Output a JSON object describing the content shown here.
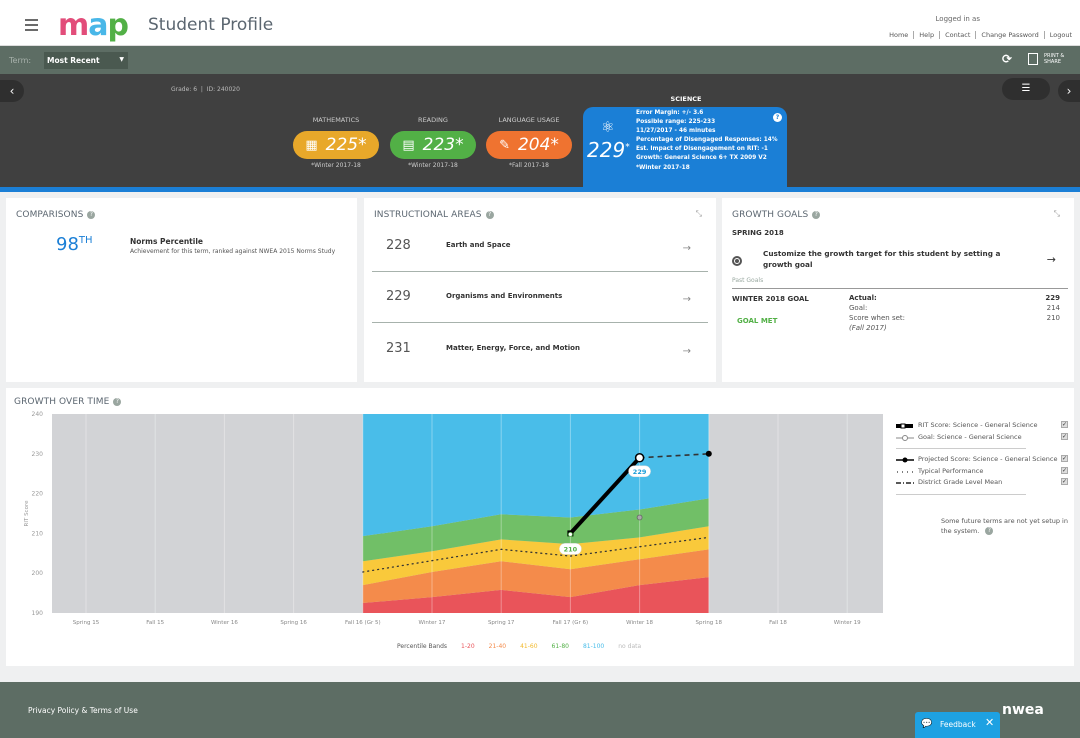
{
  "header": {
    "app_title": "Student Profile",
    "logo_text": "map",
    "logged_in_label": "Logged in as",
    "links": [
      "Home",
      "Help",
      "Contact",
      "Change Password",
      "Logout"
    ]
  },
  "term_bar": {
    "term_label": "Term:",
    "term_selected": "Most Recent",
    "refresh_icon": "refresh-icon",
    "print_label_1": "PRINT &",
    "print_label_2": "SHARE"
  },
  "student_bar": {
    "grade": "Grade: 6",
    "id": "ID: 240020",
    "prev_icon": "chevron-left",
    "next_icon": "chevron-right",
    "roster_icon": "user-list-icon"
  },
  "subjects": [
    {
      "name": "MATHEMATICS",
      "score": "225*",
      "term": "*Winter 2017-18",
      "color": "#e8a82a",
      "icon": "calculator-icon"
    },
    {
      "name": "READING",
      "score": "223*",
      "term": "*Winter 2017-18",
      "color": "#52b046",
      "icon": "book-icon"
    },
    {
      "name": "LANGUAGE USAGE",
      "score": "204*",
      "term": "*Fall 2017-18",
      "color": "#ef7330",
      "icon": "pencil-paper-icon"
    }
  ],
  "science": {
    "name": "SCIENCE",
    "score": "229",
    "asterisk": "*",
    "color": "#1b7fd6",
    "details": [
      "Error Margin: +/- 3.6",
      "Possible range: 225-233",
      "11/27/2017 - 46 minutes",
      "Percentage of Disengaged Responses: 14%",
      "Est. Impact of Disengagement on RIT: -1",
      "Growth: General Science 6+ TX 2009 V2",
      "*Winter 2017-18"
    ]
  },
  "comparisons": {
    "title": "COMPARISONS",
    "percentile": "98",
    "suffix": "TH",
    "label": "Norms Percentile",
    "description": "Achievement for this term, ranked against NWEA 2015 Norms Study"
  },
  "instructional_areas": {
    "title": "INSTRUCTIONAL AREAS",
    "rows": [
      {
        "score": "228",
        "name": "Earth and Space"
      },
      {
        "score": "229",
        "name": "Organisms and Environments"
      },
      {
        "score": "231",
        "name": "Matter, Energy, Force, and Motion"
      }
    ]
  },
  "growth_goals": {
    "title": "GROWTH GOALS",
    "season": "SPRING 2018",
    "prompt": "Customize the growth target for this student by setting a growth goal",
    "past_label": "Past Goals",
    "past_goal_name": "WINTER 2018 GOAL",
    "status": "GOAL MET",
    "actual_label": "Actual:",
    "actual_value": "229",
    "goal_label": "Goal:",
    "goal_value": "214",
    "set_label": "Score when set:",
    "set_value": "210",
    "set_term": "(Fall 2017)"
  },
  "growth_over_time": {
    "title": "GROWTH OVER TIME",
    "legend": [
      {
        "label": "RIT Score: Science - General Science",
        "checked": true
      },
      {
        "label": "Goal: Science - General Science",
        "checked": true
      },
      {
        "label": "Projected Score: Science - General Science",
        "checked": true
      },
      {
        "label": "Typical Performance",
        "checked": true
      },
      {
        "label": "District Grade Level Mean",
        "checked": true
      }
    ],
    "future_note": "Some future terms are not yet setup in the system.",
    "bands_title": "Percentile Bands",
    "bands": [
      {
        "label": "1-20",
        "color": "#e9545a"
      },
      {
        "label": "21-40",
        "color": "#f48b4b"
      },
      {
        "label": "41-60",
        "color": "#f9c93b"
      },
      {
        "label": "61-80",
        "color": "#71bf67"
      },
      {
        "label": "81-100",
        "color": "#49bde9"
      },
      {
        "label": "no data",
        "color": "#cccccc"
      }
    ]
  },
  "chart_data": {
    "type": "area",
    "title": "GROWTH OVER TIME",
    "ylabel": "RIT Score",
    "xlabel": "",
    "ylim": [
      190,
      240
    ],
    "yticks": [
      190,
      200,
      210,
      220,
      230,
      240
    ],
    "categories": [
      "Spring 15",
      "Fall 15",
      "Winter 16",
      "Spring 16",
      "Fall 16 (Gr 5)",
      "Winter 17",
      "Spring 17",
      "Fall 17 (Gr 6)",
      "Winter 18",
      "Spring 18",
      "Fall 18",
      "Winter 19"
    ],
    "band_range": [
      "Fall 16 (Gr 5)",
      "Spring 18"
    ],
    "band_boundaries": {
      "x": [
        "Fall 16 (Gr 5)",
        "Winter 17",
        "Spring 17",
        "Fall 17 (Gr 6)",
        "Winter 18",
        "Spring 18"
      ],
      "p20": [
        192.5,
        194,
        195.8,
        194,
        197,
        199
      ],
      "p40": [
        197,
        200.3,
        203,
        201,
        203.5,
        206
      ],
      "p60": [
        203,
        205.5,
        208.5,
        207.3,
        209,
        211.8
      ],
      "p80": [
        209.3,
        211.8,
        214.8,
        214,
        216,
        218.8
      ]
    },
    "series": [
      {
        "name": "RIT Score: Science - General Science",
        "x": [
          "Fall 17 (Gr 6)",
          "Winter 18"
        ],
        "values": [
          210,
          229
        ],
        "labels": [
          "210",
          "229"
        ]
      },
      {
        "name": "Goal: Science - General Science",
        "x": [
          "Winter 18"
        ],
        "values": [
          214
        ]
      },
      {
        "name": "Projected Score: Science - General Science",
        "x": [
          "Winter 18",
          "Spring 18"
        ],
        "values": [
          229,
          230
        ]
      },
      {
        "name": "Typical Performance",
        "x": [
          "Fall 16 (Gr 5)",
          "Spring 17",
          "Fall 17 (Gr 6)",
          "Spring 18"
        ],
        "values": [
          200.3,
          206,
          204.3,
          209
        ]
      }
    ],
    "legend_position": "right",
    "grid": true
  },
  "footer": {
    "link": "Privacy Policy & Terms of Use",
    "brand": "nwea",
    "feedback_label": "Feedback"
  }
}
